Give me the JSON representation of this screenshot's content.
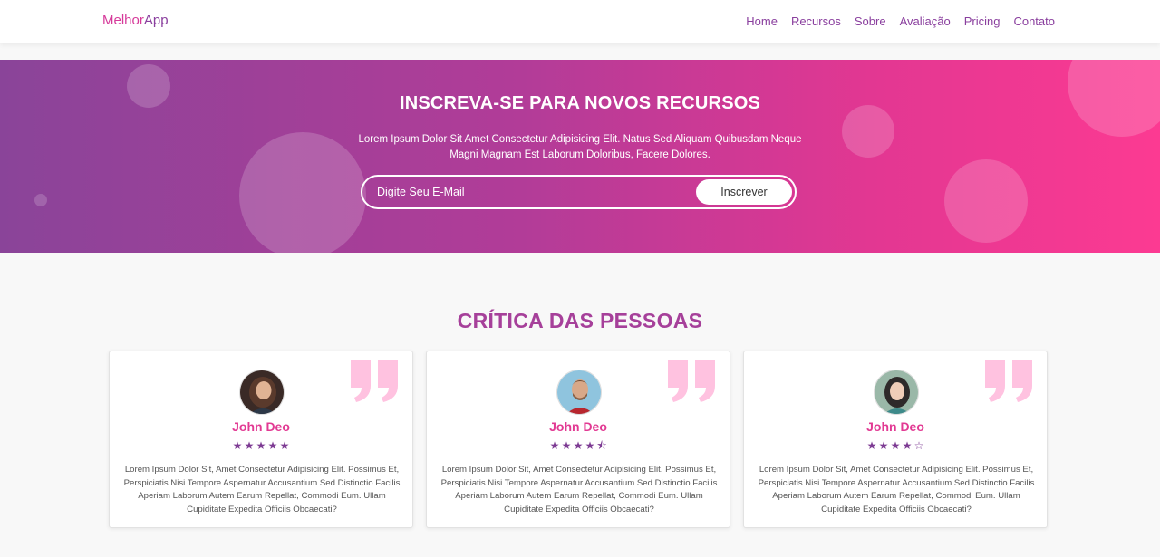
{
  "navbar": {
    "logo_part1": "Melhor",
    "logo_part2": "App",
    "links": [
      "Home",
      "Recursos",
      "Sobre",
      "Avaliação",
      "Pricing",
      "Contato"
    ]
  },
  "newsletter": {
    "title": "INSCREVA-SE PARA NOVOS RECURSOS",
    "description": "Lorem Ipsum Dolor Sit Amet Consectetur Adipisicing Elit. Natus Sed Aliquam Quibusdam Neque Magni Magnam Est Laborum Doloribus, Facere Dolores.",
    "email_placeholder": "Digite Seu E-Mail",
    "button_label": "Inscrever"
  },
  "reviews": {
    "title": "CRÍTICA DAS PESSOAS",
    "items": [
      {
        "name": "John Deo",
        "rating": 5,
        "stars": [
          "★",
          "★",
          "★",
          "★",
          "★"
        ],
        "text": "Lorem Ipsum Dolor Sit, Amet Consectetur Adipisicing Elit. Possimus Et, Perspiciatis Nisi Tempore Aspernatur Accusantium Sed Distinctio Facilis Aperiam Laborum Autem Earum Repellat, Commodi Eum. Ullam Cupiditate Expedita Officiis Obcaecati?"
      },
      {
        "name": "John Deo",
        "rating": 4.5,
        "stars": [
          "★",
          "★",
          "★",
          "★",
          "⯪"
        ],
        "text": "Lorem Ipsum Dolor Sit, Amet Consectetur Adipisicing Elit. Possimus Et, Perspiciatis Nisi Tempore Aspernatur Accusantium Sed Distinctio Facilis Aperiam Laborum Autem Earum Repellat, Commodi Eum. Ullam Cupiditate Expedita Officiis Obcaecati?"
      },
      {
        "name": "John Deo",
        "rating": 4,
        "stars": [
          "★",
          "★",
          "★",
          "★",
          "☆"
        ],
        "text": "Lorem Ipsum Dolor Sit, Amet Consectetur Adipisicing Elit. Possimus Et, Perspiciatis Nisi Tempore Aspernatur Accusantium Sed Distinctio Facilis Aperiam Laborum Autem Earum Repellat, Commodi Eum. Ullam Cupiditate Expedita Officiis Obcaecati?"
      }
    ]
  },
  "colors": {
    "brand_pink": "#e23a93",
    "brand_purple": "#8a3f9e",
    "gradient_start": "#8a4499",
    "gradient_end": "#fc3a92",
    "quote_pink": "#ffc2e0"
  },
  "icons": {
    "quote": "quote-icon",
    "star": "star-icon",
    "avatar": "user-avatar"
  }
}
